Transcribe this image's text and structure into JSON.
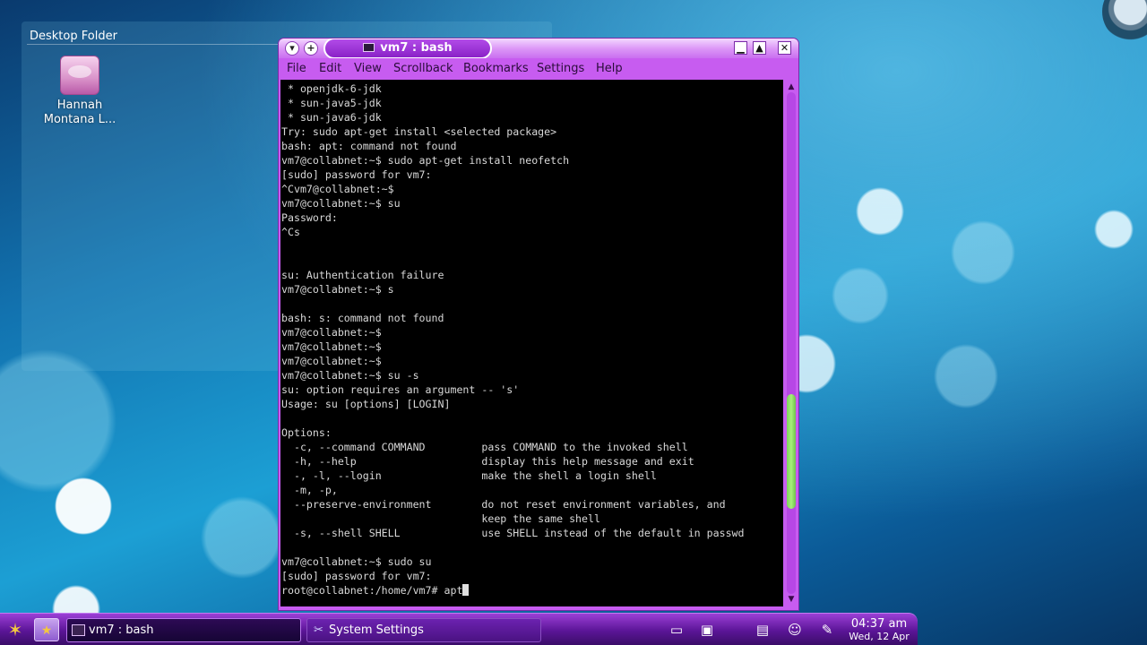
{
  "desktop": {
    "folder_title": "Desktop Folder",
    "icon_label_line1": "Hannah",
    "icon_label_line2": "Montana L...",
    "icon": "hard-drive-icon"
  },
  "window": {
    "title": "vm7 : bash",
    "accent_color": "#c75cf0",
    "menu": [
      "File",
      "Edit",
      "View",
      "Scrollback",
      "Bookmarks",
      "Settings",
      "Help"
    ]
  },
  "terminal": {
    "lines": [
      " * openjdk-6-jdk",
      " * sun-java5-jdk",
      " * sun-java6-jdk",
      "Try: sudo apt-get install <selected package>",
      "bash: apt: command not found",
      "vm7@collabnet:~$ sudo apt-get install neofetch",
      "[sudo] password for vm7:",
      "^Cvm7@collabnet:~$",
      "vm7@collabnet:~$ su",
      "Password:",
      "^Cs",
      "",
      "",
      "su: Authentication failure",
      "vm7@collabnet:~$ s",
      "",
      "bash: s: command not found",
      "vm7@collabnet:~$",
      "vm7@collabnet:~$",
      "vm7@collabnet:~$",
      "vm7@collabnet:~$ su -s",
      "su: option requires an argument -- 's'",
      "Usage: su [options] [LOGIN]",
      "",
      "Options:",
      "  -c, --command COMMAND         pass COMMAND to the invoked shell",
      "  -h, --help                    display this help message and exit",
      "  -, -l, --login                make the shell a login shell",
      "  -m, -p,",
      "  --preserve-environment        do not reset environment variables, and",
      "                                keep the same shell",
      "  -s, --shell SHELL             use SHELL instead of the default in passwd",
      "",
      "vm7@collabnet:~$ sudo su",
      "[sudo] password for vm7:",
      "root@collabnet:/home/vm7# apt"
    ],
    "scroll_position": 0.78
  },
  "taskbar": {
    "tasks": [
      {
        "label": "vm7 : bash",
        "active": true
      },
      {
        "label": "System Settings",
        "active": false
      }
    ],
    "clock_time": "04:37 am",
    "clock_date": "Wed, 12 Apr",
    "tray_icons": [
      "network-icon",
      "pager-icon",
      "clipboard-icon",
      "chat-icon",
      "notes-icon"
    ]
  }
}
